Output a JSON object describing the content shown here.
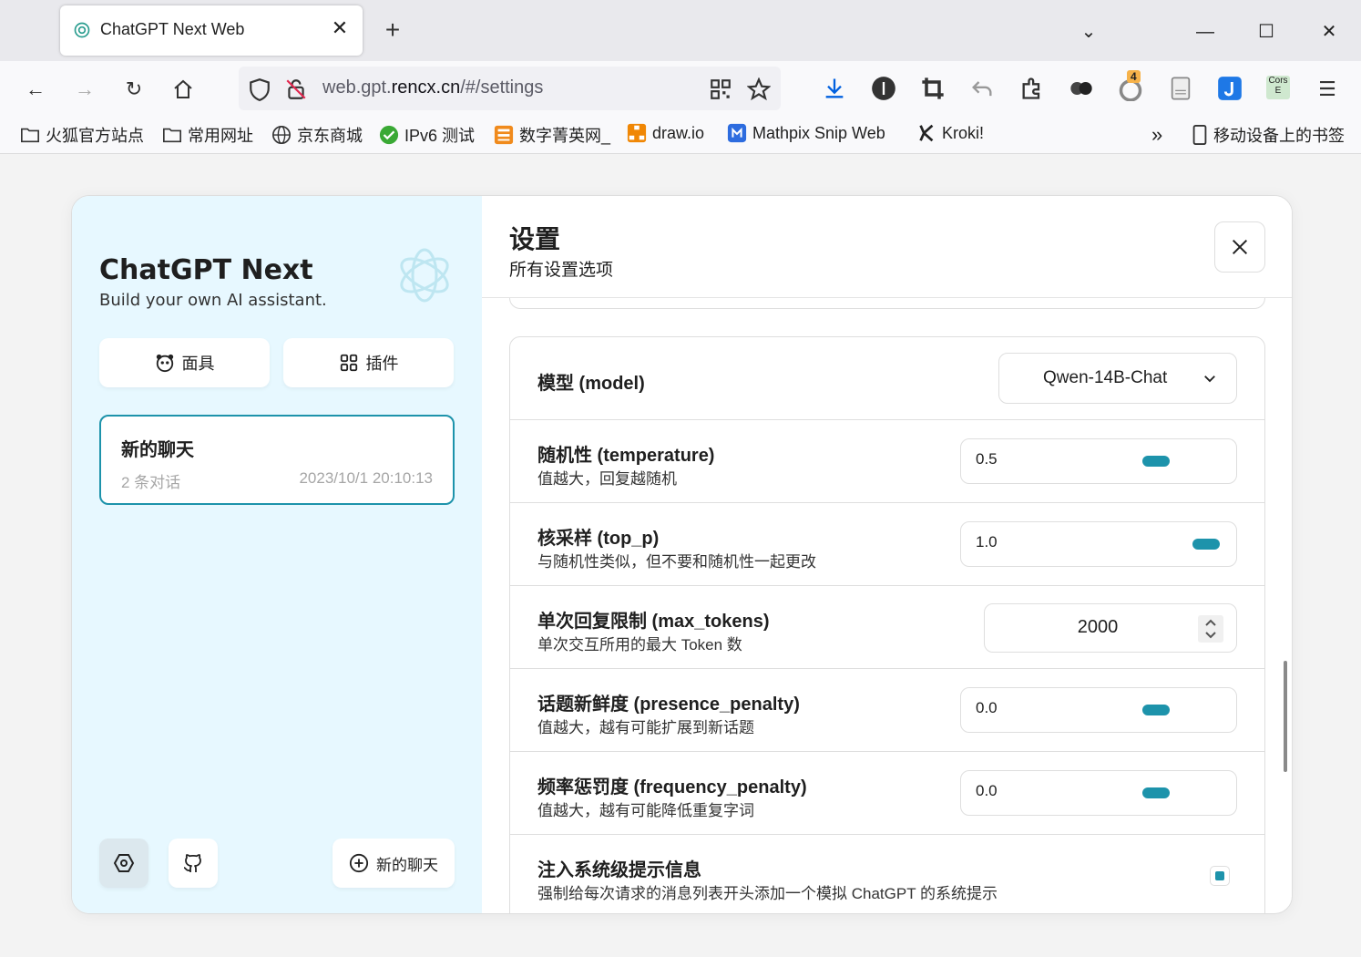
{
  "browser": {
    "tab_title": "ChatGPT Next Web",
    "url_host": "web.gpt.",
    "url_domain": "rencx.cn",
    "url_path": "/#/settings",
    "ext_badge": "4",
    "cors_label": "Cors"
  },
  "bookmarks": [
    {
      "label": "火狐官方站点"
    },
    {
      "label": "常用网址"
    },
    {
      "label": "京东商城"
    },
    {
      "label": "IPv6 测试"
    },
    {
      "label": "数字菁英网_"
    },
    {
      "label": "draw.io"
    },
    {
      "label": "Mathpix Snip Web"
    },
    {
      "label": "Kroki!"
    },
    {
      "label": "移动设备上的书签"
    }
  ],
  "sidebar": {
    "title": "ChatGPT Next",
    "subtitle": "Build your own AI assistant.",
    "mask_label": "面具",
    "plugin_label": "插件",
    "chat": {
      "title": "新的聊天",
      "count": "2 条对话",
      "date": "2023/10/1 20:10:13"
    },
    "new_chat_label": "新的聊天"
  },
  "settings": {
    "title": "设置",
    "subtitle": "所有设置选项",
    "model": {
      "label": "模型 (model)",
      "value": "Qwen-14B-Chat"
    },
    "temperature": {
      "label": "随机性 (temperature)",
      "desc": "值越大，回复越随机",
      "value": "0.5",
      "fraction": 0.5
    },
    "top_p": {
      "label": "核采样 (top_p)",
      "desc": "与随机性类似，但不要和随机性一起更改",
      "value": "1.0",
      "fraction": 1.0
    },
    "max_tokens": {
      "label": "单次回复限制 (max_tokens)",
      "desc": "单次交互所用的最大 Token 数",
      "value": "2000"
    },
    "presence_penalty": {
      "label": "话题新鲜度 (presence_penalty)",
      "desc": "值越大，越有可能扩展到新话题",
      "value": "0.0",
      "fraction": 0.5
    },
    "frequency_penalty": {
      "label": "频率惩罚度 (frequency_penalty)",
      "desc": "值越大，越有可能降低重复字词",
      "value": "0.0",
      "fraction": 0.5
    },
    "inject_system": {
      "label": "注入系统级提示信息",
      "desc": "强制给每次请求的消息列表开头添加一个模拟 ChatGPT 的系统提示",
      "checked": true
    }
  },
  "colors": {
    "accent": "#1d93ab",
    "sidebar_bg": "#e7f8ff"
  }
}
